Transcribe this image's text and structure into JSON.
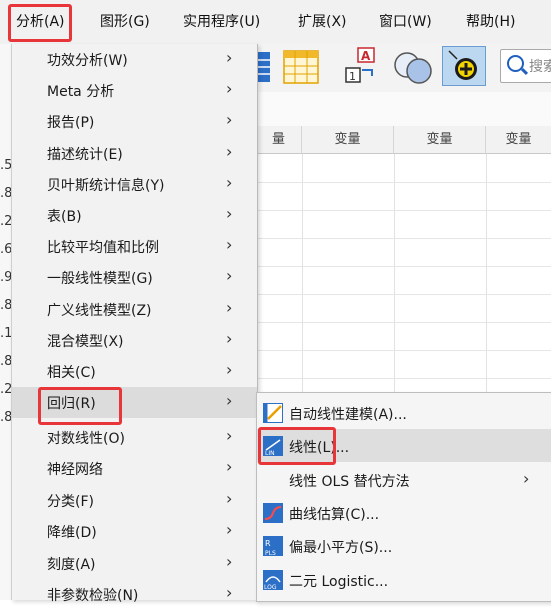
{
  "menubar": {
    "items": [
      {
        "label": "分析(A)",
        "active": true
      },
      {
        "label": "图形(G)"
      },
      {
        "label": "实用程序(U)"
      },
      {
        "label": "扩展(X)"
      },
      {
        "label": "窗口(W)"
      },
      {
        "label": "帮助(H)"
      }
    ]
  },
  "toolbar": {
    "search_text": "搜索"
  },
  "grid": {
    "col_headers": [
      "量",
      "变量",
      "变量",
      "变量"
    ],
    "left_digits": [
      ".5",
      ".8",
      ".2",
      ".6",
      ".9",
      ".8",
      ".1",
      ".8",
      ".2",
      ".8"
    ]
  },
  "analyze_menu": {
    "items": [
      {
        "label": "功效分析(W)"
      },
      {
        "label": "Meta 分析"
      },
      {
        "label": "报告(P)"
      },
      {
        "label": "描述统计(E)"
      },
      {
        "label": "贝叶斯统计信息(Y)"
      },
      {
        "label": "表(B)"
      },
      {
        "label": "比较平均值和比例"
      },
      {
        "label": "一般线性模型(G)"
      },
      {
        "label": "广义线性模型(Z)"
      },
      {
        "label": "混合模型(X)"
      },
      {
        "label": "相关(C)"
      },
      {
        "label": "回归(R)",
        "highlighted": true
      },
      {
        "label": "对数线性(O)"
      },
      {
        "label": "神经网络"
      },
      {
        "label": "分类(F)"
      },
      {
        "label": "降维(D)"
      },
      {
        "label": "刻度(A)"
      },
      {
        "label": "非参数检验(N)"
      }
    ]
  },
  "regression_submenu": {
    "items": [
      {
        "label": "自动线性建模(A)...",
        "icon": "auto-linear-icon"
      },
      {
        "label": "线性(L)...",
        "icon": "linear-regression-icon",
        "highlighted": true
      },
      {
        "label": "线性 OLS 替代方法",
        "icon": "",
        "has_submenu": true
      },
      {
        "label": "曲线估算(C)...",
        "icon": "curve-estimation-icon"
      },
      {
        "label": "偏最小平方(S)...",
        "icon": "pls-icon"
      },
      {
        "label": "二元 Logistic...",
        "icon": "logistic-icon"
      }
    ]
  },
  "colors": {
    "highlight_box": "#e8353a",
    "menu_bg": "#f2f2f2",
    "hover_bg": "#dcdcdc"
  }
}
